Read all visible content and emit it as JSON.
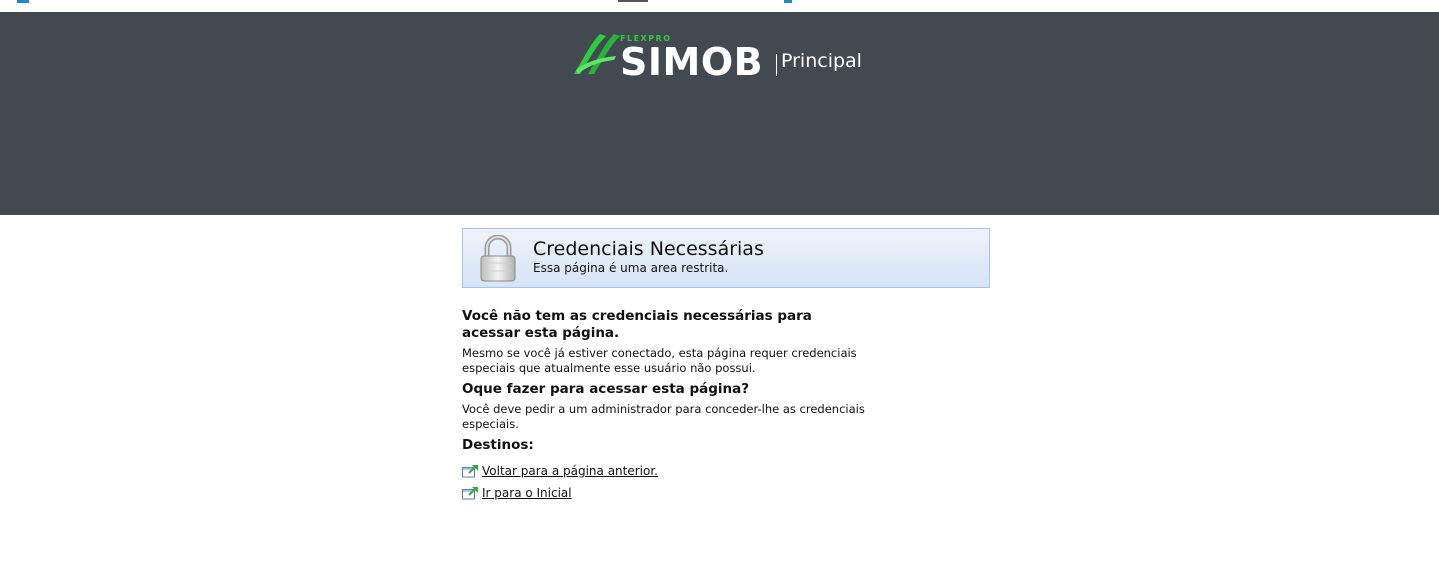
{
  "header": {
    "brand_small": "FLEXPRO",
    "brand": "SIMOB",
    "section": "Principal",
    "colors": {
      "background": "#434950",
      "accent": "#2ecc40"
    }
  },
  "alert": {
    "icon": "lock-icon",
    "title": "Credenciais Necessárias",
    "subtitle": "Essa página é uma area restrita."
  },
  "body": {
    "heading1": "Você não tem as credenciais necessárias para acessar esta página.",
    "paragraph1": "Mesmo se você já estiver conectado, esta página requer credenciais especiais que atualmente esse usuário não possui.",
    "heading2": "Oque fazer para acessar esta página?",
    "paragraph2": "Você deve pedir a um administrador para conceder-lhe as credenciais especiais.",
    "destinations_label": "Destinos:",
    "destinations": [
      {
        "icon": "external-link-icon",
        "label": "Voltar para a página anterior."
      },
      {
        "icon": "external-link-icon",
        "label": "Ir para o Inicial"
      }
    ]
  }
}
